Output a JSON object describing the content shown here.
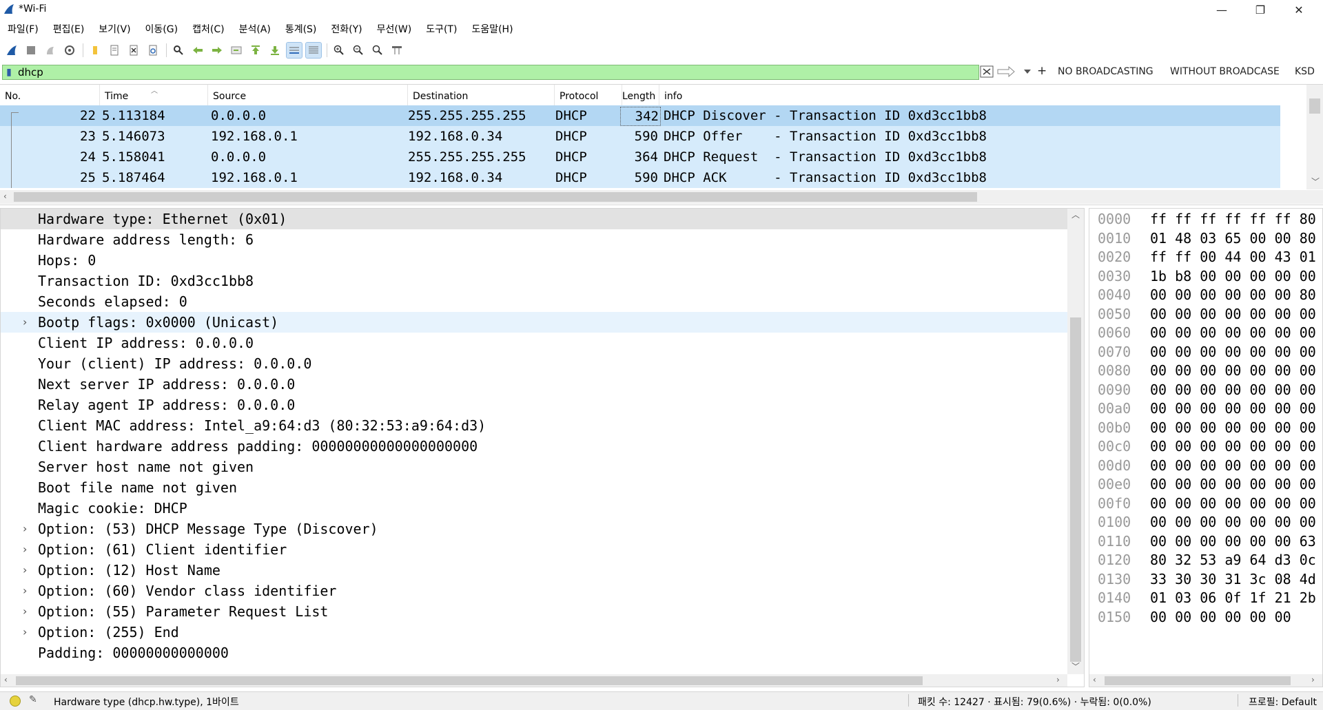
{
  "window": {
    "title": "*Wi-Fi",
    "minimize": "—",
    "maximize": "❐",
    "close": "✕"
  },
  "menu": [
    "파일(F)",
    "편집(E)",
    "보기(V)",
    "이동(G)",
    "캡처(C)",
    "분석(A)",
    "통계(S)",
    "전화(Y)",
    "무선(W)",
    "도구(T)",
    "도움말(H)"
  ],
  "toolbar": {
    "icons": [
      "shark-fin-icon",
      "stop-icon",
      "restart-icon",
      "options-icon",
      "open-folder-icon",
      "open-file-icon",
      "close-file-icon",
      "reload-icon",
      "find-icon",
      "back-icon",
      "forward-icon",
      "goto-icon",
      "first-icon",
      "last-icon",
      "autoscroll-icon",
      "colorize-icon",
      "zoom-in-icon",
      "zoom-out-icon",
      "zoom-normal-icon",
      "resize-columns-icon"
    ]
  },
  "filter": {
    "value": "dhcp",
    "placeholder": "",
    "buttons": [
      "NO BROADCASTING",
      "WITHOUT BROADCASE",
      "KSD"
    ],
    "add_button": "+"
  },
  "packet_list": {
    "columns": [
      "No.",
      "Time",
      "Source",
      "Destination",
      "Protocol",
      "Length",
      "info"
    ],
    "rows": [
      {
        "no": "22",
        "time": "5.113184",
        "source": "0.0.0.0",
        "destination": "255.255.255.255",
        "protocol": "DHCP",
        "length": "342",
        "info": "DHCP Discover - Transaction ID 0xd3cc1bb8"
      },
      {
        "no": "23",
        "time": "5.146073",
        "source": "192.168.0.1",
        "destination": "192.168.0.34",
        "protocol": "DHCP",
        "length": "590",
        "info": "DHCP Offer    - Transaction ID 0xd3cc1bb8"
      },
      {
        "no": "24",
        "time": "5.158041",
        "source": "0.0.0.0",
        "destination": "255.255.255.255",
        "protocol": "DHCP",
        "length": "364",
        "info": "DHCP Request  - Transaction ID 0xd3cc1bb8"
      },
      {
        "no": "25",
        "time": "5.187464",
        "source": "192.168.0.1",
        "destination": "192.168.0.34",
        "protocol": "DHCP",
        "length": "590",
        "info": "DHCP ACK      - Transaction ID 0xd3cc1bb8"
      }
    ]
  },
  "details": {
    "rows": [
      {
        "text": "Hardware type: Ethernet (0x01)",
        "expandable": false
      },
      {
        "text": "Hardware address length: 6",
        "expandable": false
      },
      {
        "text": "Hops: 0",
        "expandable": false
      },
      {
        "text": "Transaction ID: 0xd3cc1bb8",
        "expandable": false
      },
      {
        "text": "Seconds elapsed: 0",
        "expandable": false
      },
      {
        "text": "Bootp flags: 0x0000 (Unicast)",
        "expandable": true
      },
      {
        "text": "Client IP address: 0.0.0.0",
        "expandable": false
      },
      {
        "text": "Your (client) IP address: 0.0.0.0",
        "expandable": false
      },
      {
        "text": "Next server IP address: 0.0.0.0",
        "expandable": false
      },
      {
        "text": "Relay agent IP address: 0.0.0.0",
        "expandable": false
      },
      {
        "text": "Client MAC address: Intel_a9:64:d3 (80:32:53:a9:64:d3)",
        "expandable": false
      },
      {
        "text": "Client hardware address padding: 00000000000000000000",
        "expandable": false
      },
      {
        "text": "Server host name not given",
        "expandable": false
      },
      {
        "text": "Boot file name not given",
        "expandable": false
      },
      {
        "text": "Magic cookie: DHCP",
        "expandable": false
      },
      {
        "text": "Option: (53) DHCP Message Type (Discover)",
        "expandable": true
      },
      {
        "text": "Option: (61) Client identifier",
        "expandable": true
      },
      {
        "text": "Option: (12) Host Name",
        "expandable": true
      },
      {
        "text": "Option: (60) Vendor class identifier",
        "expandable": true
      },
      {
        "text": "Option: (55) Parameter Request List",
        "expandable": true
      },
      {
        "text": "Option: (255) End",
        "expandable": true
      },
      {
        "text": "Padding: 00000000000000",
        "expandable": false
      }
    ],
    "expander_glyph": "›"
  },
  "bytes": {
    "rows": [
      {
        "offset": "0000",
        "hex": "ff ff ff ff ff ff 80"
      },
      {
        "offset": "0010",
        "hex": "01 48 03 65 00 00 80"
      },
      {
        "offset": "0020",
        "hex": "ff ff 00 44 00 43 01"
      },
      {
        "offset": "0030",
        "hex": "1b b8 00 00 00 00 00"
      },
      {
        "offset": "0040",
        "hex": "00 00 00 00 00 00 80"
      },
      {
        "offset": "0050",
        "hex": "00 00 00 00 00 00 00"
      },
      {
        "offset": "0060",
        "hex": "00 00 00 00 00 00 00"
      },
      {
        "offset": "0070",
        "hex": "00 00 00 00 00 00 00"
      },
      {
        "offset": "0080",
        "hex": "00 00 00 00 00 00 00"
      },
      {
        "offset": "0090",
        "hex": "00 00 00 00 00 00 00"
      },
      {
        "offset": "00a0",
        "hex": "00 00 00 00 00 00 00"
      },
      {
        "offset": "00b0",
        "hex": "00 00 00 00 00 00 00"
      },
      {
        "offset": "00c0",
        "hex": "00 00 00 00 00 00 00"
      },
      {
        "offset": "00d0",
        "hex": "00 00 00 00 00 00 00"
      },
      {
        "offset": "00e0",
        "hex": "00 00 00 00 00 00 00"
      },
      {
        "offset": "00f0",
        "hex": "00 00 00 00 00 00 00"
      },
      {
        "offset": "0100",
        "hex": "00 00 00 00 00 00 00"
      },
      {
        "offset": "0110",
        "hex": "00 00 00 00 00 00 63"
      },
      {
        "offset": "0120",
        "hex": "80 32 53 a9 64 d3 0c"
      },
      {
        "offset": "0130",
        "hex": "33 30 30 31 3c 08 4d"
      },
      {
        "offset": "0140",
        "hex": "01 03 06 0f 1f 21 2b"
      },
      {
        "offset": "0150",
        "hex": "00 00 00 00 00 00"
      }
    ]
  },
  "status": {
    "field_info": "Hardware type (dhcp.hw.type), 1바이트",
    "counts": "패킷 수: 12427 · 표시됨: 79(0.6%) · 누락됨: 0(0.0%)",
    "profile": "프로필: Default"
  },
  "colors": {
    "filter_valid": "#aff0a7",
    "selected_row": "#b3d7f3",
    "related_row": "#d6ebfb",
    "selected_detail": "#e2e2e2"
  }
}
